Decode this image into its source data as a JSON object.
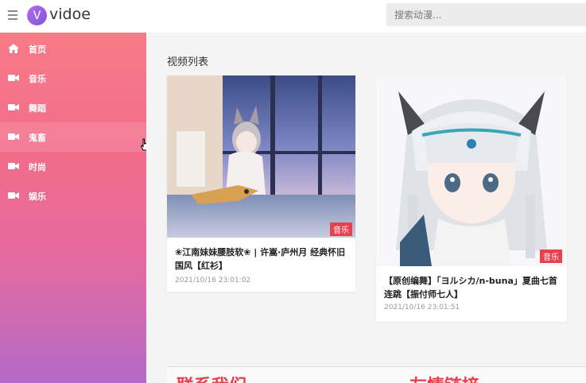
{
  "brand": {
    "logo_letter": "V",
    "name": "vidoe"
  },
  "search": {
    "placeholder": "搜索动漫..."
  },
  "sidebar": {
    "items": [
      {
        "label": "首页",
        "icon": "home-icon"
      },
      {
        "label": "音乐",
        "icon": "video-camera-icon"
      },
      {
        "label": "舞蹈",
        "icon": "video-camera-icon"
      },
      {
        "label": "鬼畜",
        "icon": "video-camera-icon"
      },
      {
        "label": "时尚",
        "icon": "video-camera-icon"
      },
      {
        "label": "娱乐",
        "icon": "video-camera-icon"
      }
    ]
  },
  "main": {
    "section_title": "视频列表",
    "videos": [
      {
        "title": "❀江南妹妹腰肢软❀ | 许嵩·庐州月 经典怀旧国风【红衫】",
        "time": "2021/10/16 23:01:02",
        "tag": "音乐"
      },
      {
        "title": "【原创编舞】「ヨルシカ/n-buna」夏曲七首连跳【振付师七人】",
        "time": "2021/10/16 23:01:51",
        "tag": "音乐"
      }
    ],
    "bottom_left": "联系我们",
    "bottom_right": "友情链接"
  },
  "colors": {
    "accent": "#e8404e",
    "sidebar_top": "#f77b88",
    "sidebar_bottom": "#b469c8",
    "logo": "#9b63e6"
  }
}
